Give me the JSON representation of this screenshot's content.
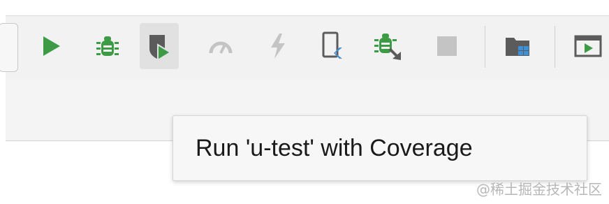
{
  "toolbar": {
    "buttons": [
      {
        "icon": "run-icon",
        "color": "#3d9b46"
      },
      {
        "icon": "debug-icon",
        "color": "#3d9b46"
      },
      {
        "icon": "run-with-coverage-icon",
        "active": true
      },
      {
        "icon": "profile-icon",
        "enabled": false
      },
      {
        "icon": "apply-changes-icon",
        "enabled": false
      },
      {
        "icon": "device-manager-icon"
      },
      {
        "icon": "attach-debugger-icon"
      },
      {
        "icon": "stop-icon",
        "enabled": false
      },
      {
        "icon": "project-structure-icon"
      },
      {
        "icon": "run-window-icon"
      }
    ]
  },
  "tooltip": {
    "text": "Run 'u-test' with Coverage"
  },
  "watermark": {
    "text": "@稀土掘金技术社区"
  },
  "colors": {
    "green": "#3d9b46",
    "gray_icon": "#5b5b5b",
    "disabled_icon": "#c4c4c4",
    "blue_accent": "#3d8fd6"
  }
}
